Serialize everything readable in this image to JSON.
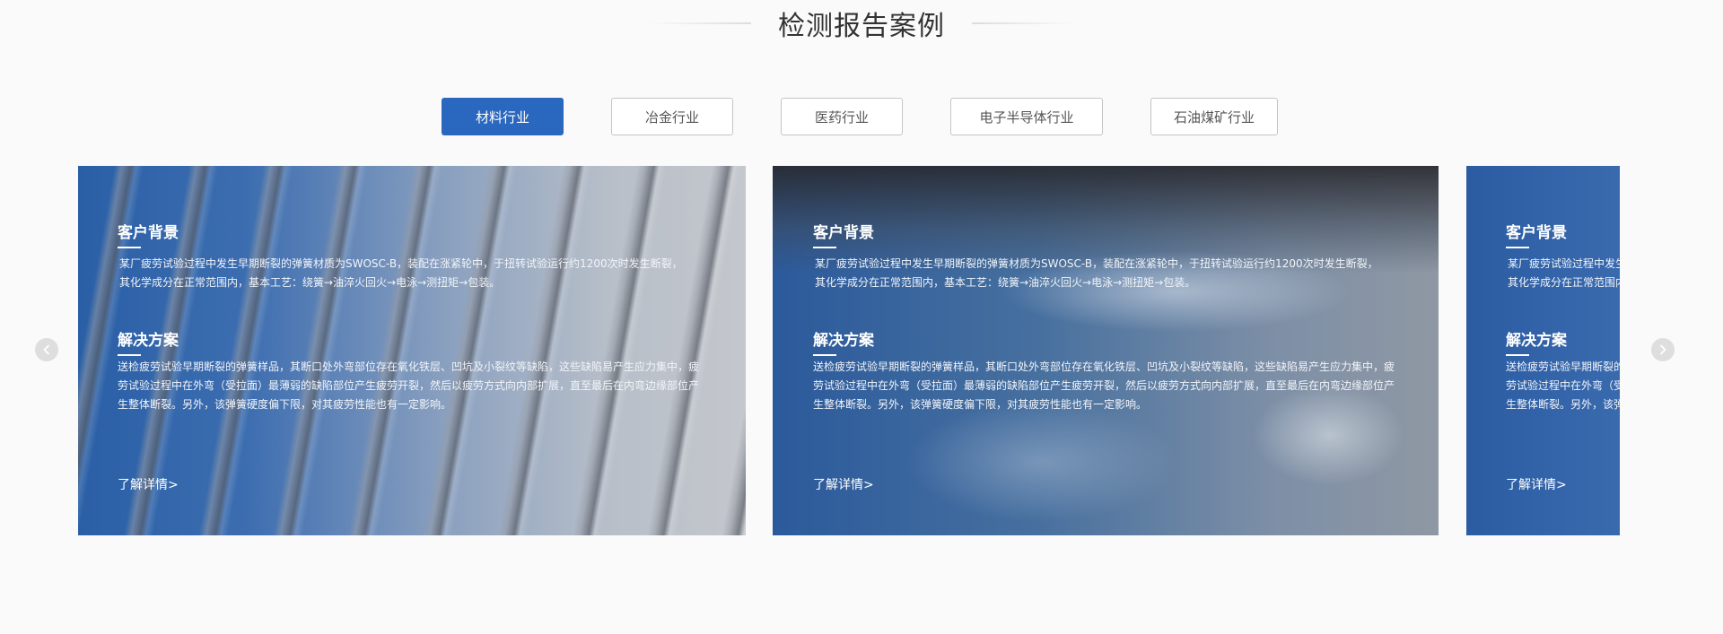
{
  "section": {
    "title": "检测报告案例"
  },
  "tabs": [
    {
      "label": "材料行业",
      "active": true
    },
    {
      "label": "冶金行业",
      "active": false
    },
    {
      "label": "医药行业",
      "active": false
    },
    {
      "label": "电子半导体行业",
      "active": false
    },
    {
      "label": "石油煤矿行业",
      "active": false
    }
  ],
  "cards": [
    {
      "bg_heading": "客户背景",
      "bg_line1": "某厂疲劳试验过程中发生早期断裂的弹簧材质为SWOSC-B，装配在涨紧轮中，于扭转试验运行约1200次时发生断裂，",
      "bg_line2": "其化学成分在正常范围内，基本工艺：绕簧→油淬火回火→电泳→测扭矩→包装。",
      "sol_heading": "解决方案",
      "sol_line1": "送检疲劳试验早期断裂的弹簧样品，其断口处外弯部位存在氧化铁层、凹坑及小裂纹等缺陷，这些缺陷易产生应力集中，疲",
      "sol_line2": "劳试验过程中在外弯（受拉面）最薄弱的缺陷部位产生疲劳开裂，然后以疲劳方式向内部扩展，直至最后在内弯边缘部位产",
      "sol_line3": "生整体断裂。另外，该弹簧硬度偏下限，对其疲劳性能也有一定影响。",
      "more": "了解详情>"
    },
    {
      "bg_heading": "客户背景",
      "bg_line1": "某厂疲劳试验过程中发生早期断裂的弹簧材质为SWOSC-B，装配在涨紧轮中，于扭转试验运行约1200次时发生断裂，",
      "bg_line2": "其化学成分在正常范围内，基本工艺：绕簧→油淬火回火→电泳→测扭矩→包装。",
      "sol_heading": "解决方案",
      "sol_line1": "送检疲劳试验早期断裂的弹簧样品，其断口处外弯部位存在氧化铁层、凹坑及小裂纹等缺陷，这些缺陷易产生应力集中，疲",
      "sol_line2": "劳试验过程中在外弯（受拉面）最薄弱的缺陷部位产生疲劳开裂，然后以疲劳方式向内部扩展，直至最后在内弯边缘部位产",
      "sol_line3": "生整体断裂。另外，该弹簧硬度偏下限，对其疲劳性能也有一定影响。",
      "more": "了解详情>"
    },
    {
      "bg_heading": "客户背景",
      "bg_line1": "某厂疲劳试验过程中发生",
      "bg_line2": "其化学成分在正常范围内",
      "sol_heading": "解决方案",
      "sol_line1": "送检疲劳试验早期断裂的",
      "sol_line2": "劳试验过程中在外弯（受",
      "sol_line3": "生整体断裂。另外，该弹",
      "more": "了解详情>"
    }
  ],
  "nav": {
    "prev_icon": "chevron-left-icon",
    "next_icon": "chevron-right-icon"
  },
  "colors": {
    "accent": "#2a67be",
    "page_bg": "#fafafa",
    "title": "#333333"
  }
}
